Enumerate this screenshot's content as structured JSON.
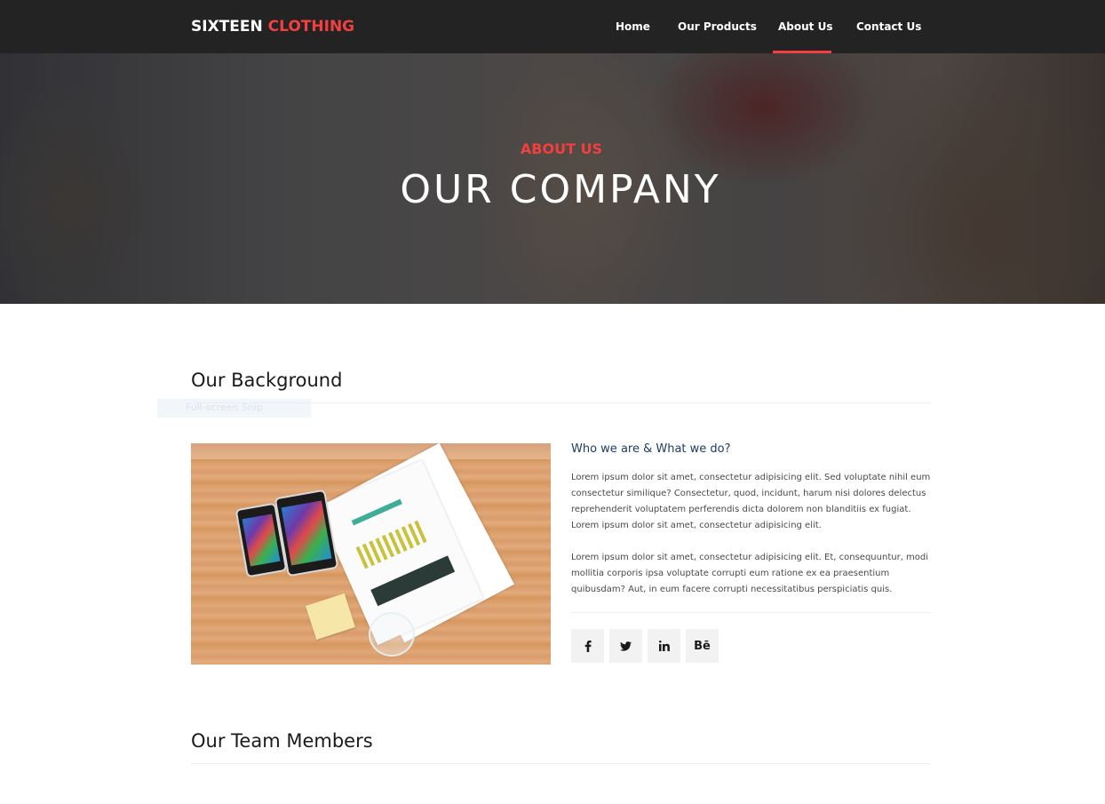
{
  "brand": {
    "part1": "SIXTEEN",
    "part2": "CLOTHING",
    "accent": "#f33f3f"
  },
  "nav": {
    "items": [
      {
        "label": "Home"
      },
      {
        "label": "Our Products"
      },
      {
        "label": "About Us",
        "active": true
      },
      {
        "label": "Contact Us"
      }
    ]
  },
  "hero": {
    "subtitle": "ABOUT US",
    "title": "OUR COMPANY"
  },
  "background": {
    "heading": "Our Background",
    "overlay_text": "Full-screen Snip",
    "subheading": "Who we are & What we do?",
    "paragraphs": [
      "Lorem ipsum dolor sit amet, consectetur adipisicing elit. Sed voluptate nihil eum consectetur similique? Consectetur, quod, incidunt, harum nisi dolores delectus reprehenderit voluptatem perferendis dicta dolorem non blanditiis ex fugiat. Lorem ipsum dolor sit amet, consectetur adipisicing elit.",
      "Lorem ipsum dolor sit amet, consectetur adipisicing elit. Et, consequuntur, modi mollitia corporis ipsa voluptate corrupti eum ratione ex ea praesentium quibusdam? Aut, in eum facere corrupti necessitatibus perspiciatis quis."
    ],
    "social": [
      {
        "icon": "facebook-icon"
      },
      {
        "icon": "twitter-icon"
      },
      {
        "icon": "linkedin-icon"
      },
      {
        "icon": "behance-icon",
        "label": "Bē"
      }
    ]
  },
  "team": {
    "heading": "Our Team Members"
  }
}
